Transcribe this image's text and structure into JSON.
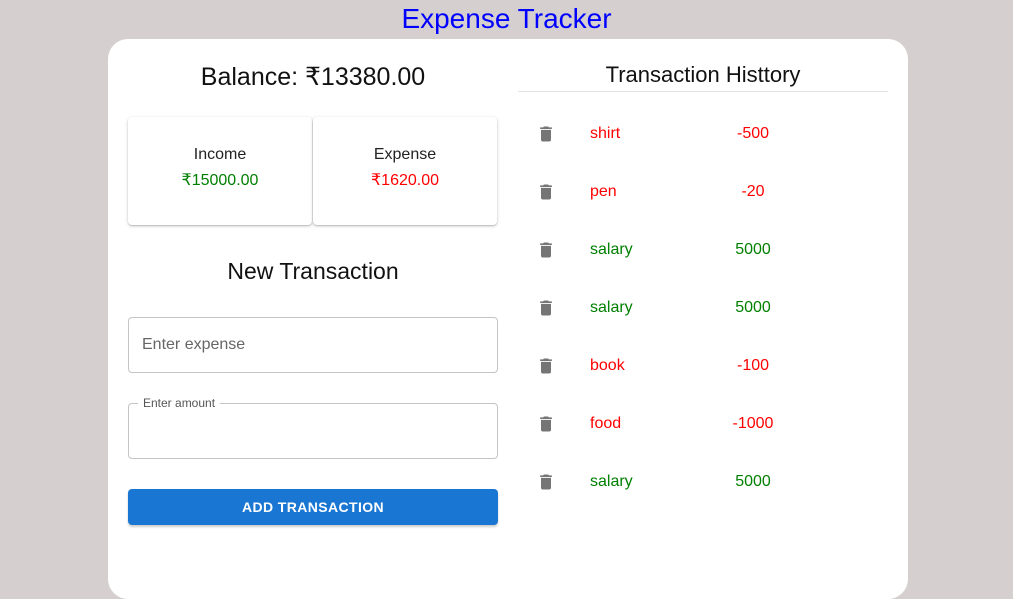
{
  "app_title": "Expense Tracker",
  "balance": "Balance: ₹13380.00",
  "summary": {
    "income_label": "Income",
    "income_value": "₹15000.00",
    "expense_label": "Expense",
    "expense_value": "₹1620.00"
  },
  "form": {
    "title": "New Transaction",
    "expense_placeholder": "Enter expense",
    "amount_label": "Enter amount",
    "amount_value": "",
    "submit_label": "ADD TRANSACTION"
  },
  "history": {
    "title": "Transaction Histtory",
    "items": [
      {
        "text": "shirt",
        "amount": "-500",
        "color": "#ff0000"
      },
      {
        "text": "pen",
        "amount": "-20",
        "color": "#ff0000"
      },
      {
        "text": "salary",
        "amount": "5000",
        "color": "#008000"
      },
      {
        "text": "salary",
        "amount": "5000",
        "color": "#008000"
      },
      {
        "text": "book",
        "amount": "-100",
        "color": "#ff0000"
      },
      {
        "text": "food",
        "amount": "-1000",
        "color": "#ff0000"
      },
      {
        "text": "salary",
        "amount": "5000",
        "color": "#008000"
      }
    ]
  },
  "icons": {
    "delete": "trash-icon"
  },
  "colors": {
    "title": "#0000ff",
    "income": "#008000",
    "expense": "#ff0000",
    "button": "#1976d2"
  }
}
